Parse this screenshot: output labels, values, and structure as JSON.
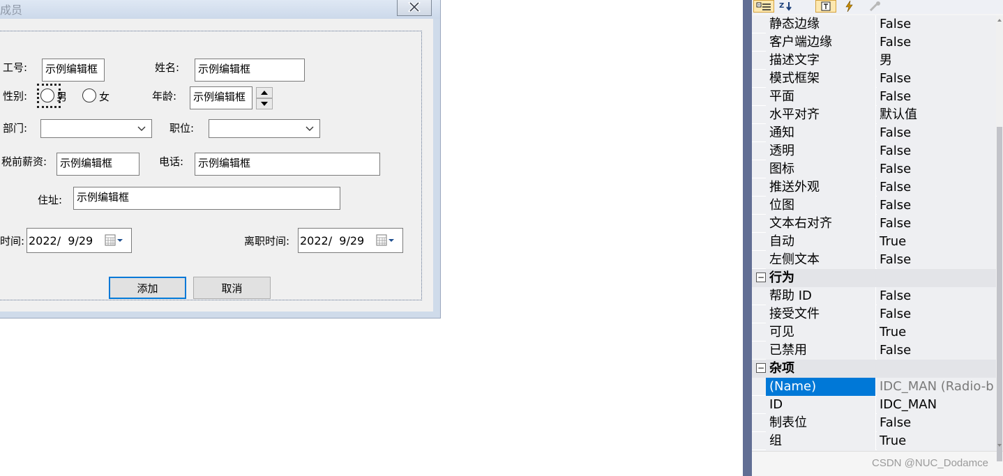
{
  "dialog": {
    "title": "成员",
    "fields": {
      "emp_id_label": "工号:",
      "emp_id_value": "示例编辑框",
      "name_label": "姓名:",
      "name_value": "示例编辑框",
      "gender_label": "性别:",
      "gender_male": "男",
      "gender_female": "女",
      "age_label": "年龄:",
      "age_value": "示例编辑框",
      "dept_label": "部门:",
      "position_label": "职位:",
      "salary_label": "税前薪资:",
      "salary_value": "示例编辑框",
      "phone_label": "电话:",
      "phone_value": "示例编辑框",
      "address_label": "住址:",
      "address_value": "示例编辑框",
      "hire_label": "时间:",
      "hire_date": "2022/  9/29",
      "leave_label": "离职时间:",
      "leave_date": "2022/  9/29"
    },
    "buttons": {
      "add": "添加",
      "cancel": "取消"
    }
  },
  "properties": {
    "rows_top": [
      {
        "name": "静态边缘",
        "value": "False"
      },
      {
        "name": "客户端边缘",
        "value": "False"
      },
      {
        "name": "描述文字",
        "value": "男"
      },
      {
        "name": "模式框架",
        "value": "False"
      },
      {
        "name": "平面",
        "value": "False"
      },
      {
        "name": "水平对齐",
        "value": "默认值"
      },
      {
        "name": "通知",
        "value": "False"
      },
      {
        "name": "透明",
        "value": "False"
      },
      {
        "name": "图标",
        "value": "False"
      },
      {
        "name": "推送外观",
        "value": "False"
      },
      {
        "name": "位图",
        "value": "False"
      },
      {
        "name": "文本右对齐",
        "value": "False"
      },
      {
        "name": "自动",
        "value": "True"
      },
      {
        "name": "左侧文本",
        "value": "False"
      }
    ],
    "category_behavior": "行为",
    "rows_behavior": [
      {
        "name": "帮助 ID",
        "value": "False"
      },
      {
        "name": "接受文件",
        "value": "False"
      },
      {
        "name": "可见",
        "value": "True"
      },
      {
        "name": "已禁用",
        "value": "False"
      }
    ],
    "category_misc": "杂项",
    "rows_misc": [
      {
        "name": "(Name)",
        "value": "IDC_MAN (Radio-b"
      },
      {
        "name": "ID",
        "value": "IDC_MAN"
      },
      {
        "name": "制表位",
        "value": "False"
      },
      {
        "name": "组",
        "value": "True"
      }
    ],
    "toggle_symbol": "−"
  },
  "watermark": "CSDN @NUC_Dodamce"
}
